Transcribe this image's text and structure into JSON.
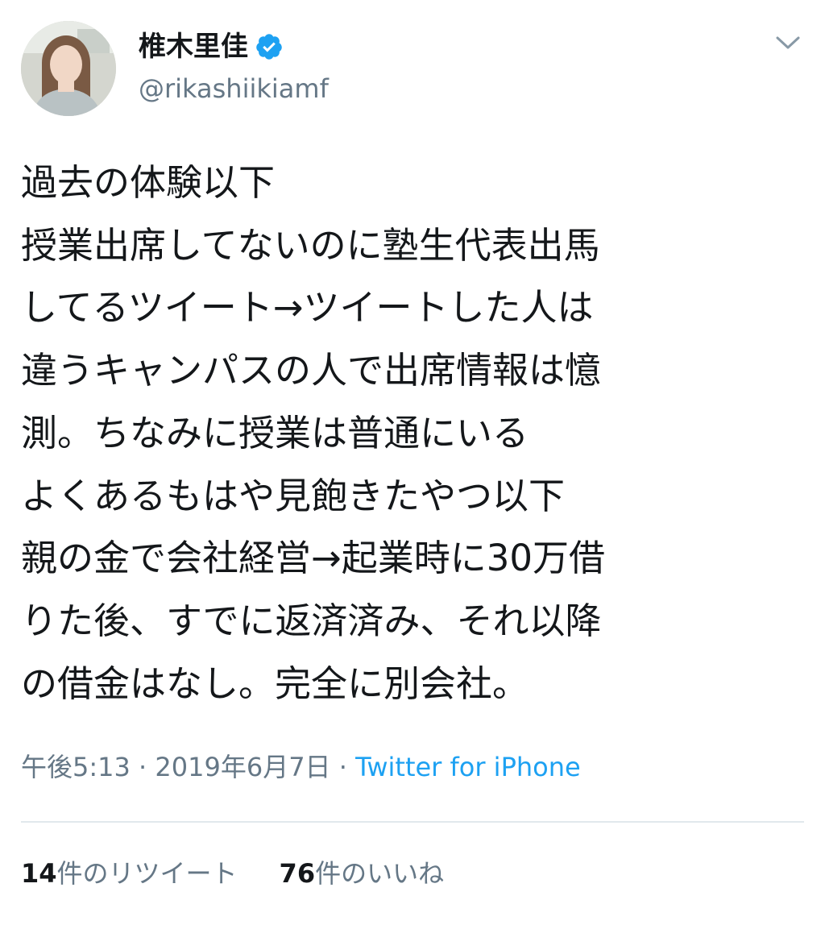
{
  "user": {
    "display_name": "椎木里佳",
    "handle": "@rikashiikiamf"
  },
  "tweet": {
    "lines": [
      "過去の体験以下",
      "授業出席してないのに塾生代表出馬",
      "してるツイート→ツイートした人は",
      "違うキャンパスの人で出席情報は憶",
      "測。ちなみに授業は普通にいる",
      "よくあるもはや見飽きたやつ以下",
      "親の金で会社経営→起業時に30万借",
      "りた後、すでに返済済み、それ以降",
      "の借金はなし。完全に別会社。"
    ],
    "time": "午後5:13",
    "date": "2019年6月7日",
    "separator": " · ",
    "source": "Twitter for iPhone"
  },
  "stats": {
    "retweets_count": "14",
    "retweets_label": "件のリツイート",
    "likes_count": "76",
    "likes_label": "件のいいね"
  },
  "colors": {
    "text": "#14171a",
    "secondary": "#657786",
    "link": "#1da1f2",
    "divider": "#e1e8ed"
  },
  "icons": {
    "verified": "verified-badge-icon",
    "menu": "chevron-down-icon"
  }
}
